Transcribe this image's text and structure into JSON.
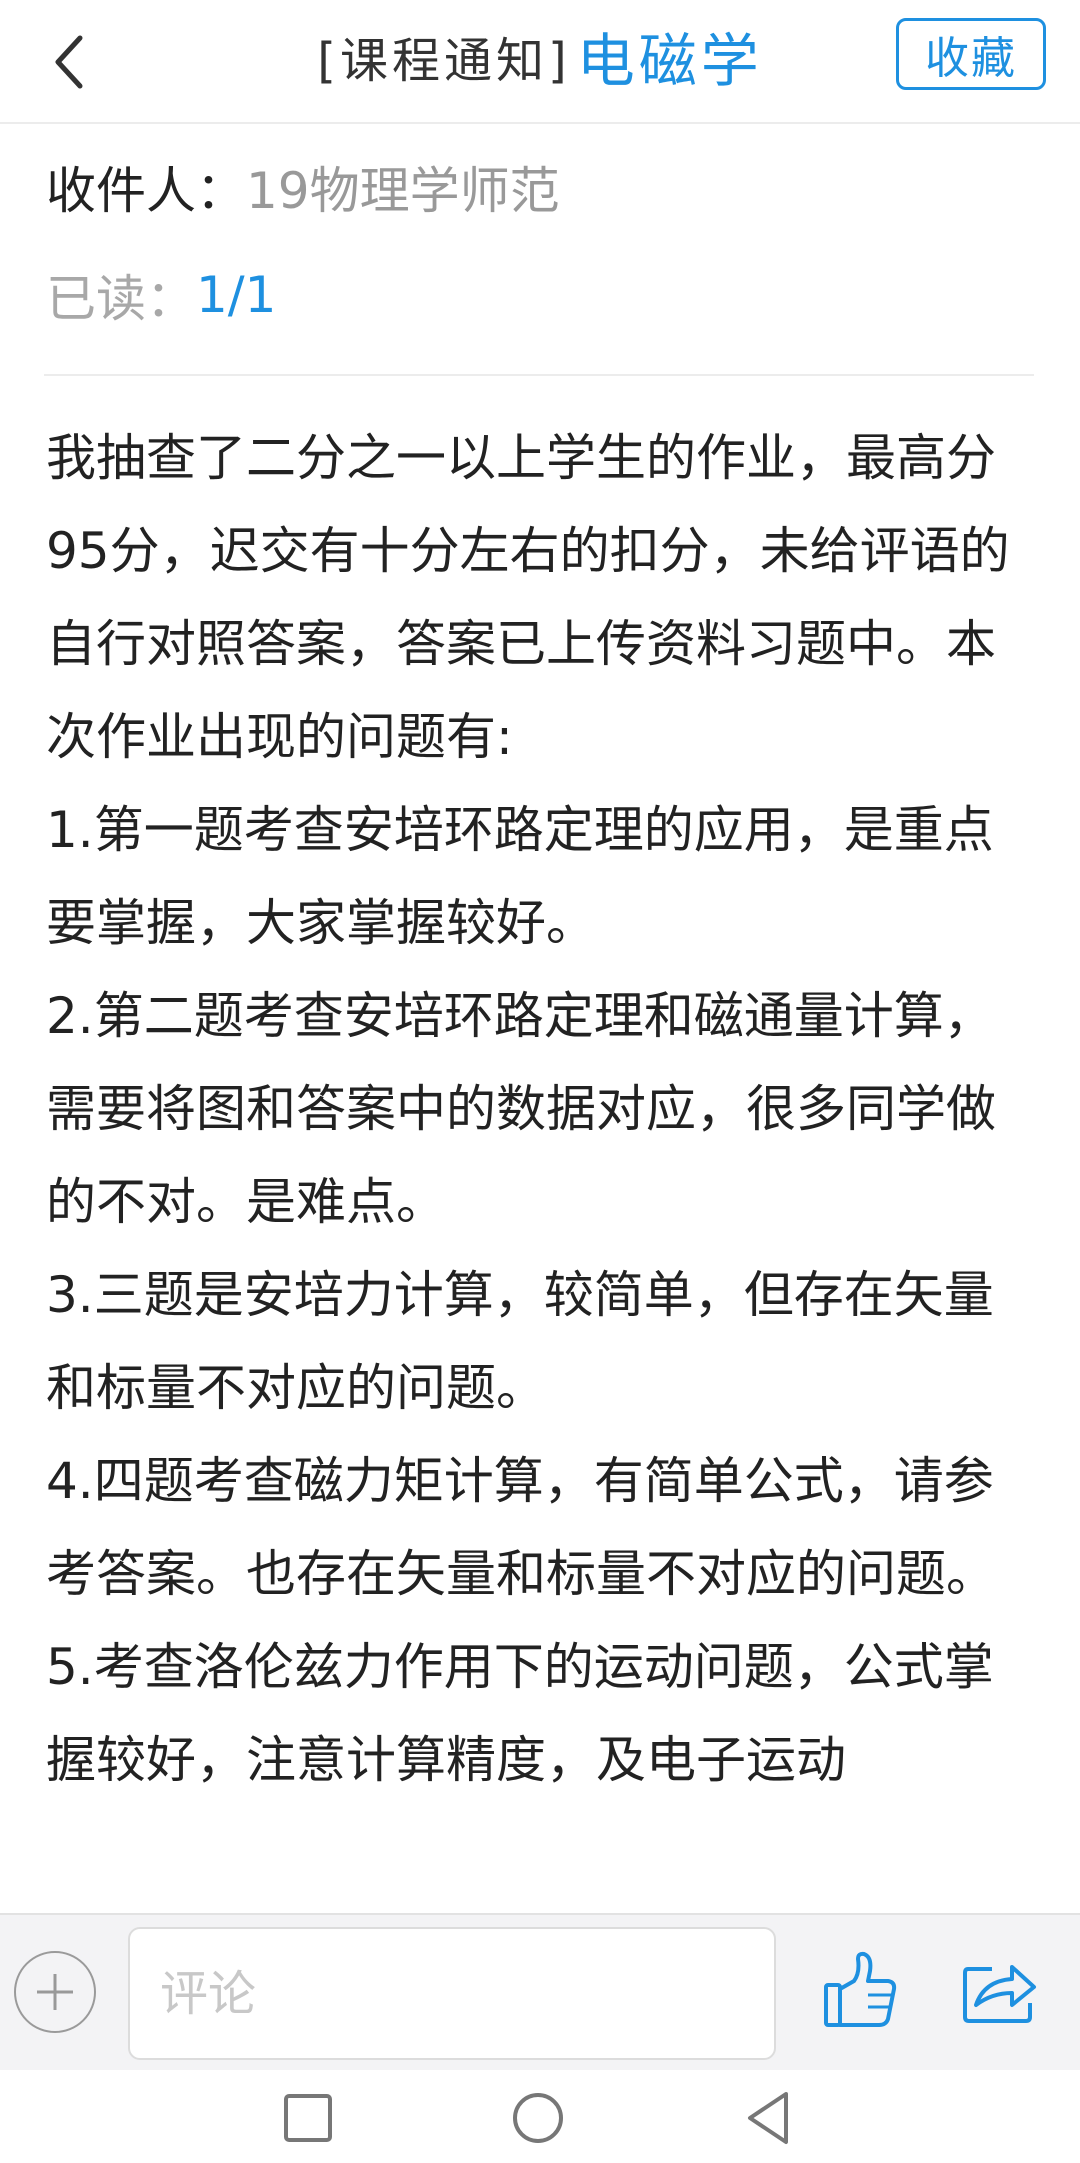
{
  "header": {
    "title_prefix": "[课程通知]",
    "course_name": "电磁学",
    "favorite_label": "收藏",
    "back_icon": "chevron-left-icon"
  },
  "meta": {
    "recipient_label": "收件人：",
    "recipient_value": "19物理学师范",
    "read_label": "已读：",
    "read_value": "1/1"
  },
  "content": {
    "paragraphs": [
      "我抽查了二分之一以上学生的作业，最高分95分，迟交有十分左右的扣分，未给评语的自行对照答案，答案已上传资料习题中。本次作业出现的问题有:",
      "1.第一题考查安培环路定理的应用，是重点要掌握，大家掌握较好。",
      "2.第二题考查安培环路定理和磁通量计算，需要将图和答案中的数据对应，很多同学做的不对。是难点。",
      "3.三题是安培力计算，较简单，但存在矢量和标量不对应的问题。",
      "4.四题考查磁力矩计算，有简单公式，请参考答案。也存在矢量和标量不对应的问题。",
      "5.考查洛伦兹力作用下的运动问题，公式掌握较好，注意计算精度，及电子运动"
    ]
  },
  "bottom_bar": {
    "comment_placeholder": "评论",
    "icons": [
      "plus-circle-icon",
      "thumbs-up-icon",
      "share-icon"
    ]
  },
  "system_nav": {
    "icons": [
      "recent-apps-square-icon",
      "home-circle-icon",
      "back-triangle-icon"
    ]
  },
  "colors": {
    "accent": "#1e90e0",
    "muted_text": "#999999",
    "body_text": "#222222",
    "bottom_bar_bg": "#f3f3f5"
  }
}
